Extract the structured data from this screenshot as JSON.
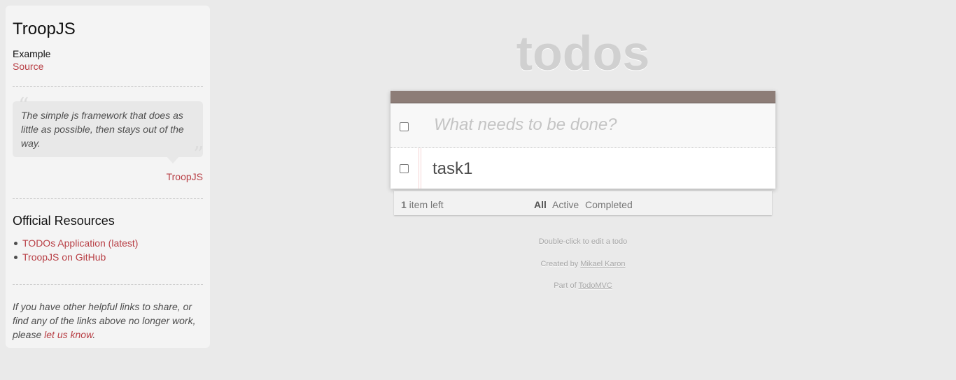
{
  "sidebar": {
    "title": "TroopJS",
    "example_label": "Example",
    "source_link": "Source",
    "quote_open": "“",
    "quote_text": "The simple js framework that does as little as possible, then stays out of the way.",
    "quote_close": "”",
    "quote_author": "TroopJS",
    "resources_heading": "Official Resources",
    "resources": [
      {
        "label": "TODOs Application (latest)"
      },
      {
        "label": "TroopJS on GitHub"
      }
    ],
    "footer_text_pre": "If you have other helpful links to share, or find any of the links above no longer work, please ",
    "footer_link": "let us know",
    "footer_text_post": "."
  },
  "app": {
    "title": "todos",
    "new_todo_placeholder": "What needs to be done?",
    "new_todo_value": "",
    "todos": [
      {
        "label": "task1",
        "completed": false
      }
    ],
    "footer": {
      "count": "1",
      "count_suffix": " item left",
      "filters": [
        "All",
        "Active",
        "Completed"
      ],
      "selected_filter": "All"
    }
  },
  "info": {
    "hint": "Double-click to edit a todo",
    "created_by_prefix": "Created by ",
    "created_by_name": "Mikael Karon",
    "part_of_prefix": "Part of ",
    "part_of_name": "TodoMVC"
  },
  "colors": {
    "accent_link": "#b83f45",
    "header_bar": "#8d7d77",
    "title_gray": "#d0d0d0"
  }
}
